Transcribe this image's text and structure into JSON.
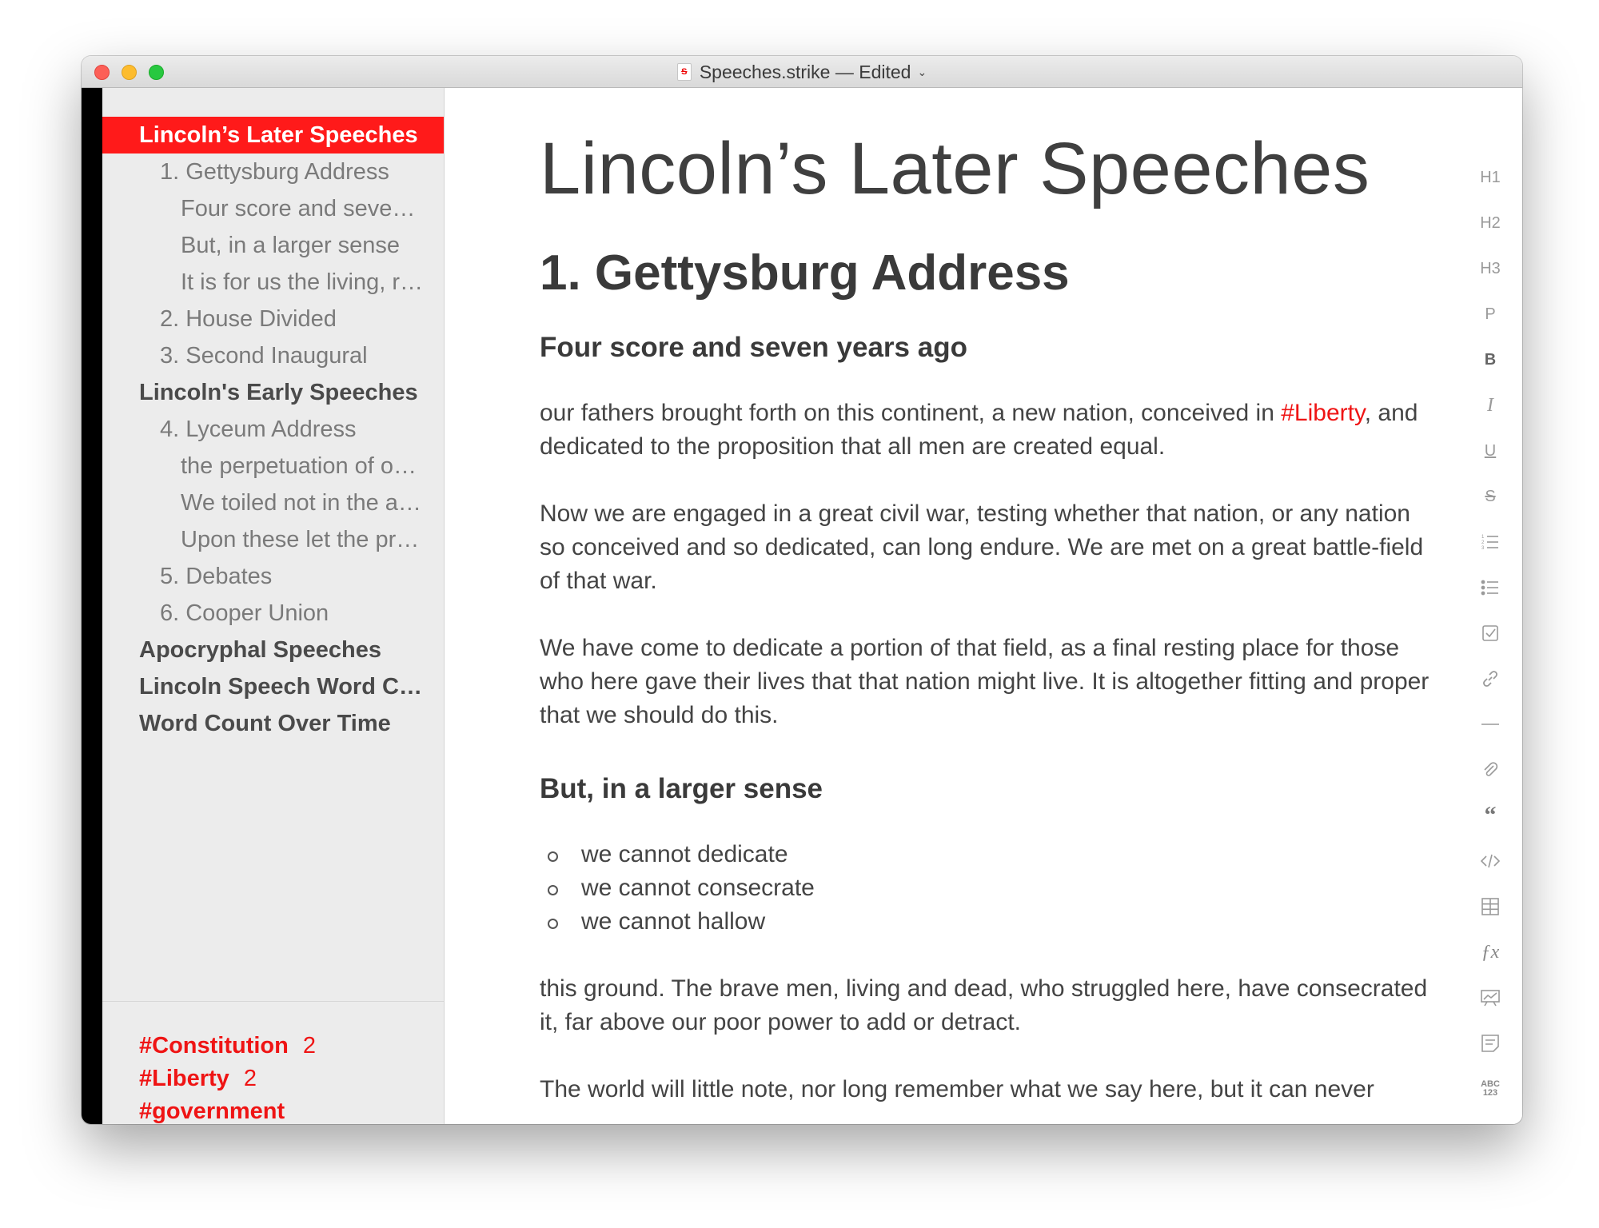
{
  "window": {
    "title": "Speeches.strike — Edited",
    "doc_icon_glyph": "S"
  },
  "sidebar": {
    "toc": [
      {
        "label": "Lincoln’s Later Speeches",
        "level": 1,
        "active": true
      },
      {
        "label": "1. Gettysburg Address",
        "level": 2
      },
      {
        "label": "Four score and seven years ago",
        "level": 3
      },
      {
        "label": "But, in a larger sense",
        "level": 3
      },
      {
        "label": "It is for us the living, rather",
        "level": 3
      },
      {
        "label": "2. House Divided",
        "level": 2
      },
      {
        "label": "3. Second Inaugural",
        "level": 2
      },
      {
        "label": "Lincoln's Early Speeches",
        "level": 1
      },
      {
        "label": "4. Lyceum Address",
        "level": 2
      },
      {
        "label": "the perpetuation of our political institutions",
        "level": 3
      },
      {
        "label": "We toiled not in the acquirement",
        "level": 3
      },
      {
        "label": "Upon these let the proud fabric",
        "level": 3
      },
      {
        "label": "5. Debates",
        "level": 2
      },
      {
        "label": "6. Cooper Union",
        "level": 2
      },
      {
        "label": "Apocryphal Speeches",
        "level": 1
      },
      {
        "label": "Lincoln Speech Word Count",
        "level": 1
      },
      {
        "label": "Word Count Over Time",
        "level": 1
      }
    ],
    "tags": [
      {
        "name": "#Constitution",
        "count": "2"
      },
      {
        "name": "#Liberty",
        "count": "2"
      },
      {
        "name": "#government",
        "count": ""
      }
    ]
  },
  "document": {
    "title": "Lincoln’s Later Speeches",
    "section_title": "1. Gettysburg Address",
    "heading_1": "Four score and seven years ago",
    "p1_before": "our fathers brought forth on this continent, a new nation, conceived in ",
    "p1_tag": "#Liberty",
    "p1_after": ", and dedicated to the proposition that all men are created equal.",
    "p2": "Now we are engaged in a great civil war, testing whether that nation, or any nation so conceived and so dedicated, can long endure. We are met on a great battle-field of that war.",
    "p3": "We have come to dedicate a portion of that field, as a final resting place for those who here gave their lives that that nation might live. It is altogether fitting and proper that we should do this.",
    "heading_2": "But, in a larger sense",
    "bullets": [
      "we cannot dedicate",
      "we cannot consecrate",
      "we cannot hallow"
    ],
    "p4": "this ground. The brave men, living and dead, who struggled here, have consecrated it, far above our poor power to add or detract.",
    "p5": "The world will little note, nor long remember what we say here, but it can never"
  },
  "toolbar": {
    "h1": "H1",
    "h2": "H2",
    "h3": "H3",
    "p": "P",
    "b": "B",
    "i": "I",
    "u": "U",
    "s": "S",
    "abc": "ABC",
    "num": "123",
    "icons": [
      "numbered-list-icon",
      "bullet-list-icon",
      "checkbox-icon",
      "link-icon",
      "horizontal-rule-icon",
      "attachment-icon",
      "quote-icon",
      "code-icon",
      "table-icon",
      "formula-icon",
      "chart-icon",
      "note-icon",
      "word-count-icon"
    ]
  },
  "colors": {
    "accent": "#ff1a1a",
    "tag": "#ef1414",
    "sidebar_bg": "#ececec",
    "text": "#3c3c3c"
  }
}
